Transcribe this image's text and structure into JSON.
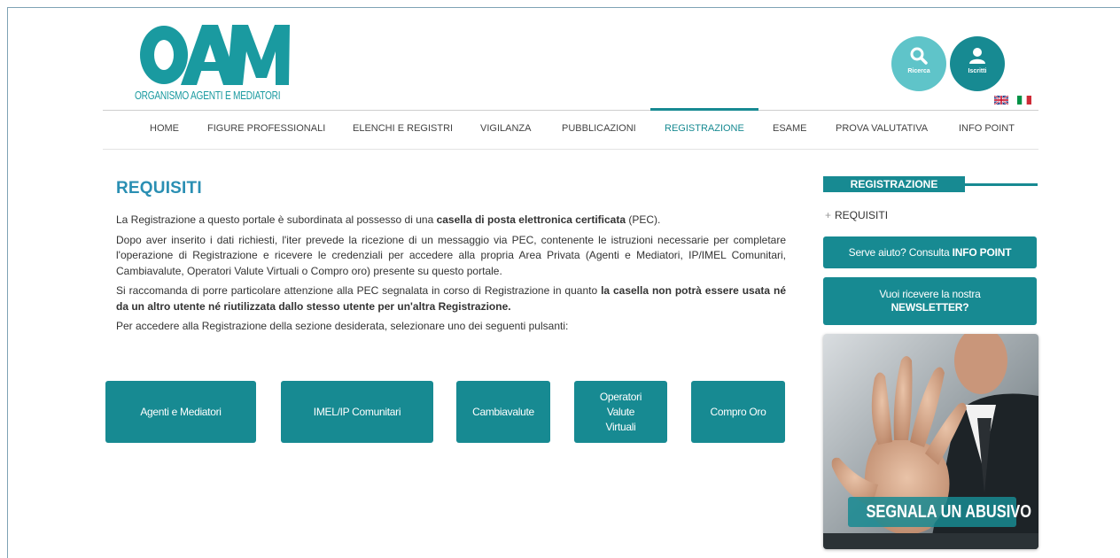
{
  "logo": {
    "letters": "OAM",
    "subtitle": "ORGANISMO AGENTI E MEDIATORI"
  },
  "header": {
    "search_label": "Ricerca",
    "user_label": "Iscritti"
  },
  "nav": {
    "items": [
      {
        "label": "HOME"
      },
      {
        "label": "FIGURE PROFESSIONALI"
      },
      {
        "label": "ELENCHI E REGISTRI"
      },
      {
        "label": "VIGILANZA"
      },
      {
        "label": "PUBBLICAZIONI"
      },
      {
        "label": "REGISTRAZIONE"
      },
      {
        "label": "ESAME"
      },
      {
        "label": "PROVA VALUTATIVA"
      },
      {
        "label": "INFO POINT"
      }
    ],
    "active": "REGISTRAZIONE"
  },
  "main": {
    "title": "REQUISITI",
    "p1_a": "La Registrazione a questo portale è subordinata al possesso di una ",
    "p1_b": "casella di posta elettronica certificata",
    "p1_c": " (PEC).",
    "p2": "Dopo aver inserito i dati richiesti, l'iter prevede la ricezione di un messaggio via PEC, contenente le istruzioni necessarie per completare l'operazione di Registrazione e ricevere le credenziali per accedere alla propria Area Privata (Agenti e Mediatori, IP/IMEL Comunitari, Cambiavalute, Operatori Valute Virtuali o Compro oro) presente su questo portale.",
    "p3_a": "Si raccomanda di porre particolare attenzione alla PEC segnalata in corso di Registrazione in quanto ",
    "p3_b": "la casella non potrà essere usata né da un altro utente né riutilizzata dallo stesso utente per un'altra Registrazione.",
    "p4": "Per accedere alla Registrazione della sezione desiderata, selezionare uno dei seguenti pulsanti:",
    "buttons": [
      {
        "label": "Agenti e Mediatori"
      },
      {
        "label": "IMEL/IP Comunitari"
      },
      {
        "label": "Cambiavalute"
      },
      {
        "label": "Operatori Valute Virtuali",
        "lines": [
          "Operatori",
          "Valute",
          "Virtuali"
        ]
      },
      {
        "label": "Compro Oro"
      }
    ]
  },
  "sidebar": {
    "tab": "REGISTRAZIONE",
    "link": "REQUISITI",
    "help_a": "Serve aiuto? Consulta ",
    "help_b": "INFO POINT",
    "news_a": "Vuoi ricevere la nostra",
    "news_b": "NEWSLETTER?",
    "promo": "SEGNALA UN ABUSIVO"
  },
  "colors": {
    "accent": "#178a92",
    "accent_light": "#5fc4c9",
    "title": "#2a8fb3"
  }
}
